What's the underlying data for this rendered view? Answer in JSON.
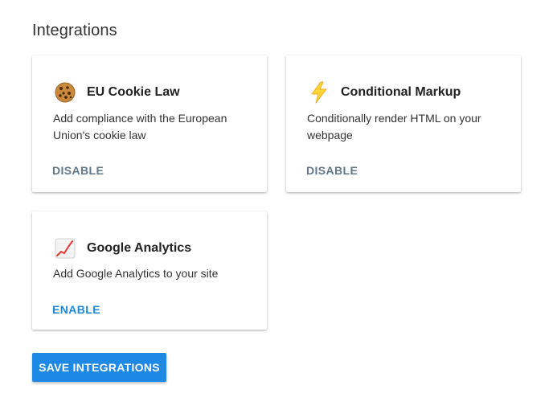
{
  "page": {
    "title": "Integrations"
  },
  "integrations": [
    {
      "icon": "cookie-icon",
      "title": "EU Cookie Law",
      "description": "Add compliance with the European Union's cookie law",
      "action": "DISABLE"
    },
    {
      "icon": "lightning-icon",
      "title": "Conditional Markup",
      "description": "Conditionally render HTML on your webpage",
      "action": "DISABLE"
    },
    {
      "icon": "chart-increasing-icon",
      "title": "Google Analytics",
      "description": "Add Google Analytics to your site",
      "action": "ENABLE"
    }
  ],
  "save_button": {
    "label": "SAVE INTEGRATIONS"
  },
  "colors": {
    "accent": "#1e88e5",
    "disable_text": "#62788a",
    "card_bg": "#ffffff"
  }
}
